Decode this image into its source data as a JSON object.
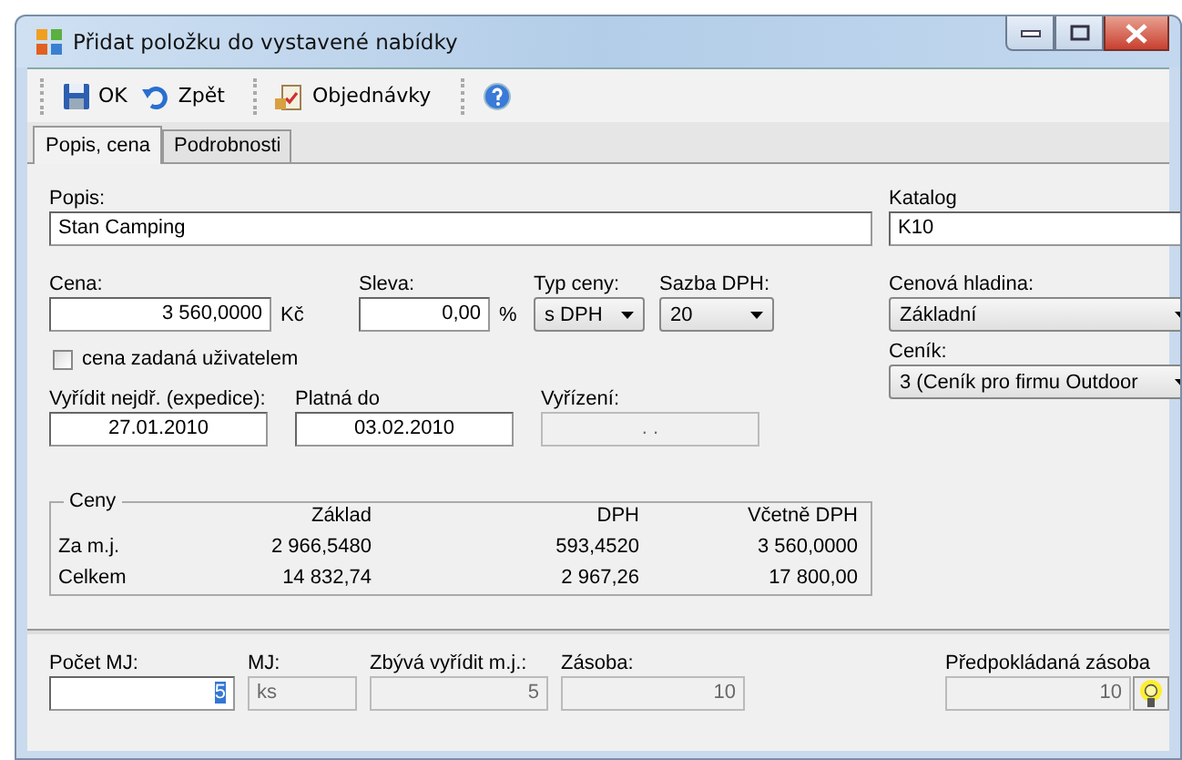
{
  "window": {
    "title": "Přidat položku do vystavené nabídky"
  },
  "toolbar": [
    {
      "kind": "save",
      "label": "OK"
    },
    {
      "kind": "undo",
      "label": "Zpět"
    },
    {
      "kind": "separator"
    },
    {
      "kind": "orders",
      "label": "Objednávky"
    },
    {
      "kind": "separator"
    },
    {
      "kind": "help"
    }
  ],
  "tabs": [
    {
      "label": "Popis, cena",
      "selected": true
    },
    {
      "label": "Podrobnosti",
      "selected": false
    }
  ],
  "description": {
    "label": "Popis:",
    "value": "Stan Camping"
  },
  "catalog": {
    "label": "Katalog",
    "value": "K10"
  },
  "price": {
    "label": "Cena:",
    "value": "3 560,0000",
    "unit": "Kč"
  },
  "discount": {
    "label": "Sleva:",
    "value": "0,00",
    "unit": "%"
  },
  "price_type": {
    "label": "Typ ceny:",
    "value": "s DPH"
  },
  "vat_rate": {
    "label": "Sazba DPH:",
    "value": "20"
  },
  "price_level": {
    "label": "Cenová hladina:",
    "value": "Základní"
  },
  "price_list": {
    "label": "Ceník:",
    "value": "3 (Ceník pro firmu Outdoor"
  },
  "user_price": {
    "label": "cena zadaná uživatelem",
    "checked": false
  },
  "dates": [
    {
      "label": "Vyřídit nejdř. (expedice):",
      "value": "27.01.2010",
      "disabled": false
    },
    {
      "label": "Platná do",
      "value": "03.02.2010",
      "disabled": false
    },
    {
      "label": "Vyřízení:",
      "value": ". .",
      "disabled": true
    }
  ],
  "prices": {
    "title": "Ceny",
    "columns": [
      "Základ",
      "DPH",
      "Včetně DPH"
    ],
    "rows": [
      {
        "label": "Za m.j.",
        "cells": [
          "2 966,5480",
          "593,4520",
          "3 560,0000"
        ]
      },
      {
        "label": "Celkem",
        "cells": [
          "14 832,74",
          "2 967,26",
          "17 800,00"
        ]
      }
    ]
  },
  "quantity": {
    "label": "Počet MJ:",
    "value": "5",
    "text_selected": true
  },
  "bottom_fields": [
    {
      "kind": "text",
      "label": "MJ:",
      "value": "ks",
      "disabled": true
    },
    {
      "kind": "number",
      "label": "Zbývá vyřídit m.j.:",
      "value": "5",
      "disabled": true
    },
    {
      "kind": "number",
      "label": "Zásoba:",
      "value": "10",
      "disabled": true
    }
  ],
  "expected_stock": {
    "label": "Předpokládaná zásoba",
    "value": "10",
    "disabled": true
  }
}
